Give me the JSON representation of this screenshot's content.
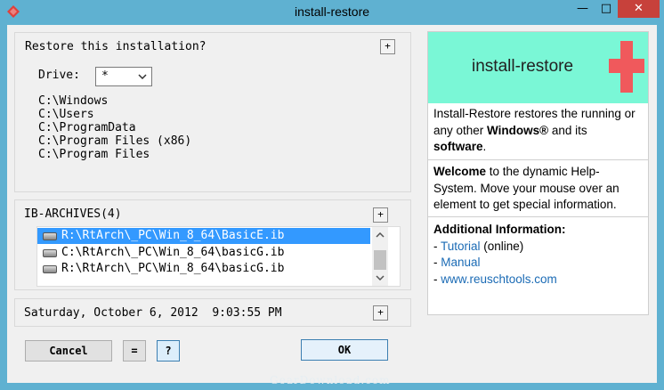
{
  "window": {
    "title": "install-restore",
    "close_glyph": "✕",
    "min_glyph": "—",
    "max_glyph": "□"
  },
  "restore": {
    "heading": "Restore this installation?",
    "drive_label": "Drive:",
    "drive_value": "*",
    "paths": [
      "C:\\Windows",
      "C:\\Users",
      "C:\\ProgramData",
      "C:\\Program Files (x86)",
      "C:\\Program Files"
    ]
  },
  "archives": {
    "heading": "IB-ARCHIVES(4)",
    "items": [
      "R:\\RtArch\\_PC\\Win_8_64\\BasicE.ib",
      "C:\\RtArch\\_PC\\Win_8_64\\basicG.ib",
      "R:\\RtArch\\_PC\\Win_8_64\\basicG.ib"
    ],
    "selected_index": 0
  },
  "datetime": {
    "text": "Saturday, October 6, 2012  9:03:55 PM"
  },
  "buttons": {
    "cancel": "Cancel",
    "equals": "=",
    "help": "?",
    "ok": "OK"
  },
  "plus_label": "+",
  "help": {
    "title": "install-restore",
    "intro_1": "Install-Restore restores the running or any other ",
    "intro_bold_1": "Windows®",
    "intro_2": " and its ",
    "intro_bold_2": "software",
    "intro_3": ".",
    "welcome_bold": "Welcome",
    "welcome_rest": " to the dynamic Help-System. Move your mouse over an element to get special information.",
    "additional_heading": "Additional Information:",
    "links": [
      {
        "prefix": "- ",
        "text": "Tutorial",
        "suffix": " (online)"
      },
      {
        "prefix": "- ",
        "text": "Manual",
        "suffix": ""
      },
      {
        "prefix": "- ",
        "text": "www.reuschtools.com",
        "suffix": ""
      }
    ]
  },
  "watermark": "GearDownload.com",
  "colors": {
    "accent_selected": "#3399ff",
    "help_header": "#7af7d6",
    "cross": "#f0595c",
    "close": "#c7413b",
    "link": "#1b6bb5"
  }
}
